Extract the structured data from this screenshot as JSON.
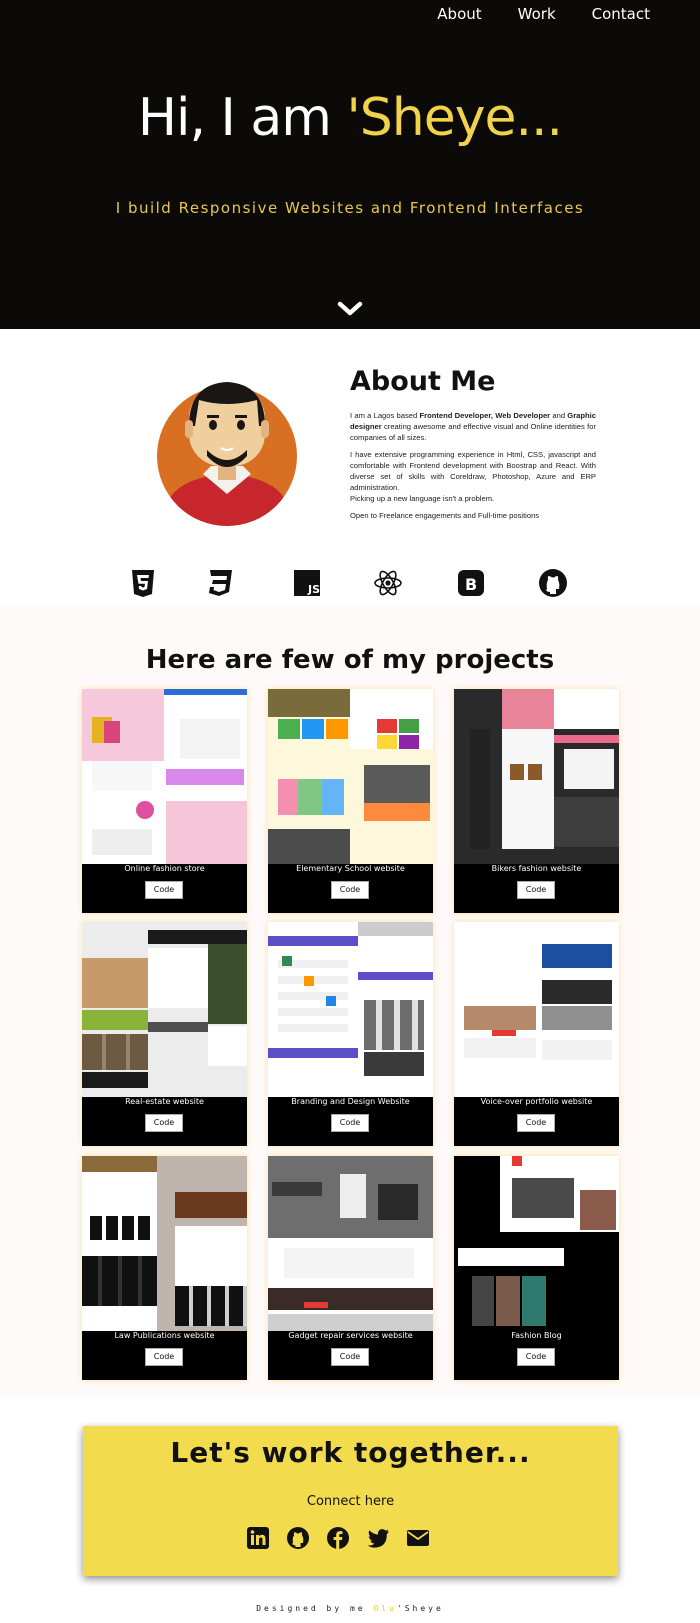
{
  "nav": {
    "about": "About",
    "work": "Work",
    "contact": "Contact"
  },
  "hero": {
    "greeting": "Hi, I am ",
    "name": "'Sheye...",
    "tagline": "I build Responsive Websites and Frontend Interfaces",
    "icon": "chevron-down-icon"
  },
  "about": {
    "title": "About Me",
    "p1_a": "I am a Lagos based ",
    "p1_b": "Frontend Developer, Web Developer",
    "p1_c": " and ",
    "p1_d": "Graphic designer",
    "p1_e": " creating awesome and effective visual and Online identities for companies of all sizes.",
    "p2": "I have extensive programming experience in Html, CSS, javascript and comfortable with Frontend development with Boostrap and React. With diverse set of skills with Coreldraw, Photoshop, Azure and ERP administration.",
    "p3": "Picking up a new language isn't a problem.",
    "p4": "Open to Freelance engagements and Full-time positions"
  },
  "skills": [
    "html5-icon",
    "css3-icon",
    "javascript-icon",
    "react-icon",
    "bootstrap-icon",
    "github-icon"
  ],
  "projects": {
    "title": "Here are few of my projects",
    "code_label": "Code",
    "items": [
      {
        "title": "Online fashion store"
      },
      {
        "title": "Elementary School website"
      },
      {
        "title": "Bikers fashion website"
      },
      {
        "title": "Real-estate website"
      },
      {
        "title": "Branding and Design Website"
      },
      {
        "title": "Voice-over portfolio website"
      },
      {
        "title": "Law Publications website"
      },
      {
        "title": "Gadget repair services website"
      },
      {
        "title": "Fashion Blog"
      }
    ]
  },
  "contact": {
    "title": "Let's work together...",
    "subtitle": "Connect here",
    "socials": [
      "linkedin-icon",
      "github-icon",
      "facebook-icon",
      "twitter-icon",
      "email-icon"
    ]
  },
  "footer": {
    "prefix": "Designed by me ",
    "accent": "Olu",
    "suffix": "'Sheye"
  },
  "colors": {
    "accent": "#f0d24c",
    "hero_bg": "#0b0a09",
    "contact_bg": "#f2dc4d"
  }
}
